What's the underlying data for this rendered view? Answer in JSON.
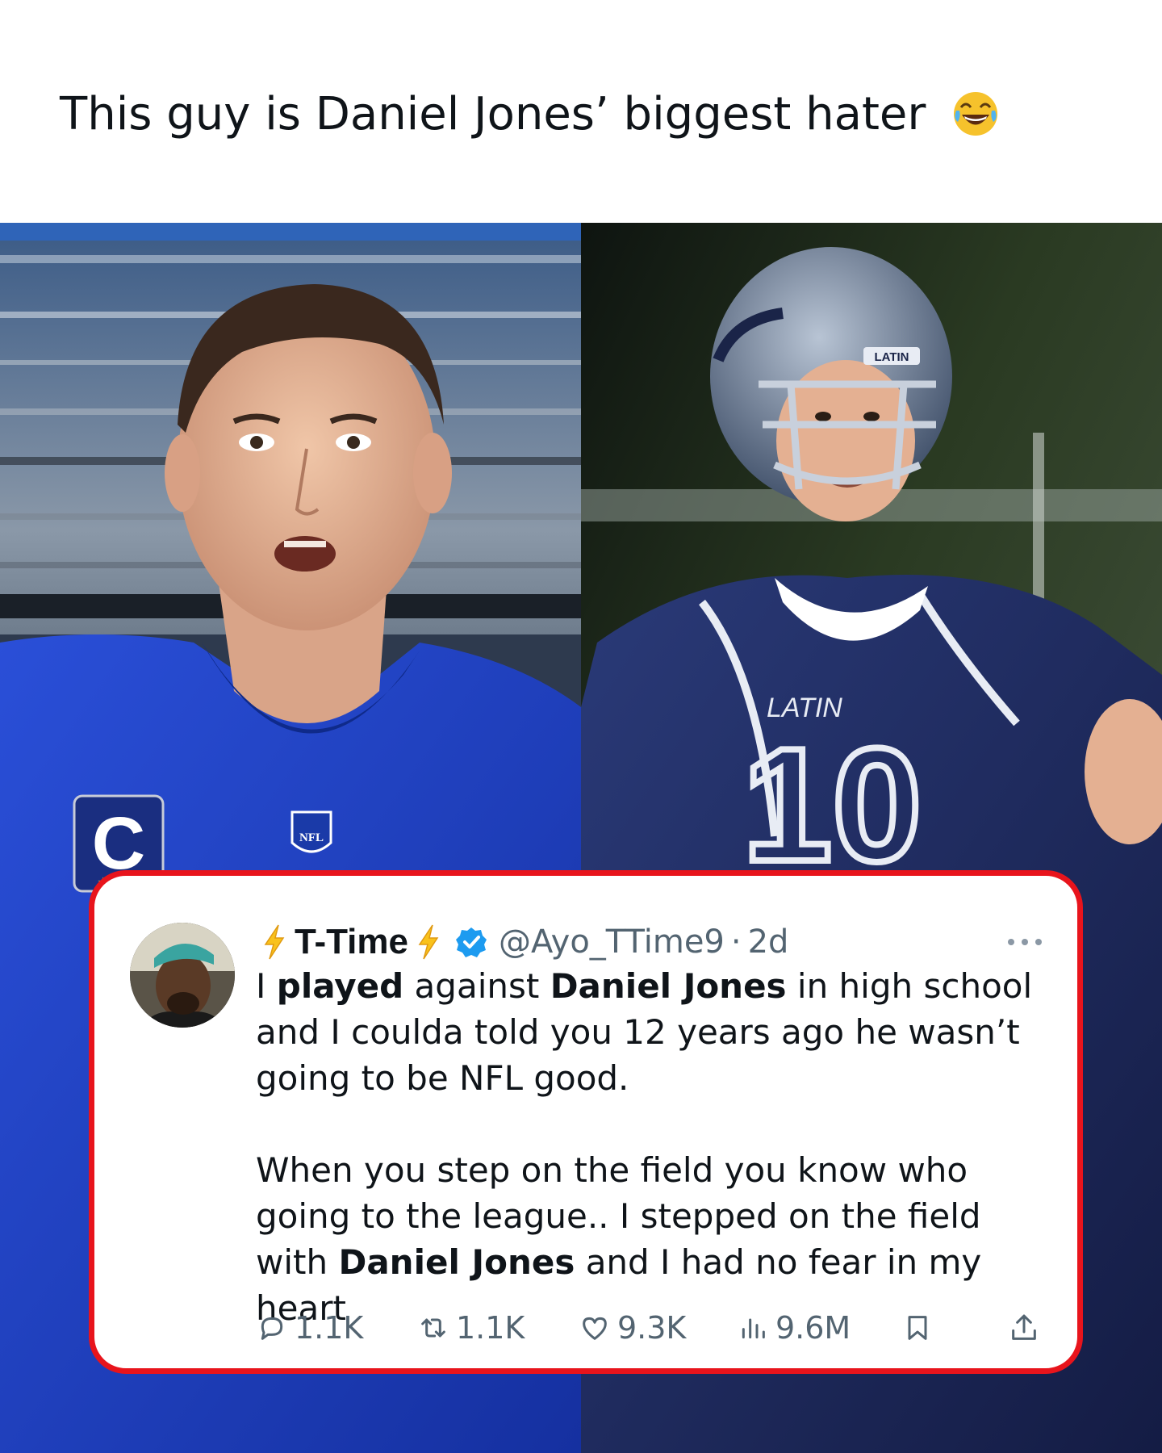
{
  "headline": {
    "text": "This guy is Daniel Jones’ biggest hater",
    "emoji": "face-with-tears-of-joy-icon"
  },
  "photos": {
    "left_jersey_patch": "C",
    "left_jersey_logo": "NFL",
    "right_jersey_text": "LATIN",
    "right_helmet_text": "LATIN",
    "right_jersey_number": "10"
  },
  "tweet": {
    "display_name": "T-Time",
    "name_emoji": "high-voltage-icon",
    "verified": true,
    "handle": "@Ayo_TTime9",
    "separator": "·",
    "time": "2d",
    "paragraph1": [
      {
        "text": "I ",
        "bold": false
      },
      {
        "text": "played",
        "bold": true
      },
      {
        "text": " against ",
        "bold": false
      },
      {
        "text": "Daniel Jones",
        "bold": true
      },
      {
        "text": " in high school and I coulda told you 12 years ago he wasn’t going to be NFL good.",
        "bold": false
      }
    ],
    "paragraph2": [
      {
        "text": "When you step on the field you know who going to the league.. I stepped on the field with ",
        "bold": false
      },
      {
        "text": "Daniel Jones",
        "bold": true
      },
      {
        "text": " and I had no fear in my heart",
        "bold": false
      }
    ],
    "stats": {
      "replies": "1.1K",
      "reposts": "1.1K",
      "likes": "9.3K",
      "views": "9.6M"
    }
  },
  "colors": {
    "card_border": "#e8141c",
    "text_primary": "#0f1419",
    "text_secondary": "#536471",
    "verified_blue": "#1d9bf0",
    "giants_blue": "#1c3fc4",
    "latin_navy": "#1f2a5c"
  }
}
